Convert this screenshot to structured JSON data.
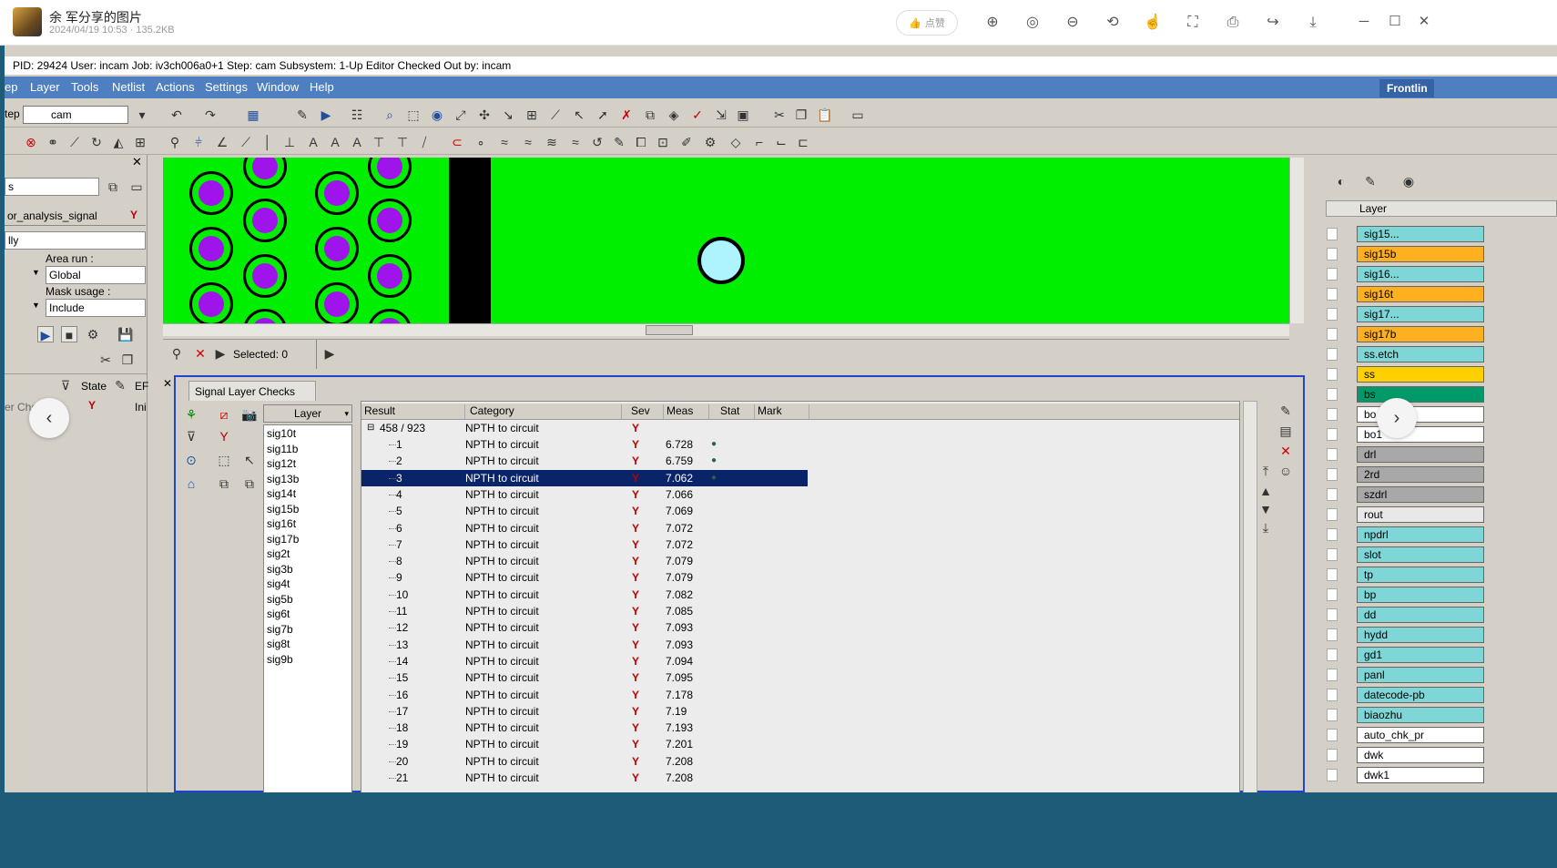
{
  "viewer": {
    "title": "余 军分享的图片",
    "meta": "2024/04/19 10:53 · 135.2KB",
    "like_label": "点赞"
  },
  "app": {
    "status": "PID: 29424   User: incam   Job: iv3ch006a0+1   Step: cam   Subsystem: 1-Up Editor   Checked Out by: incam",
    "menu": [
      "ep",
      "Layer",
      "Tools",
      "Netlist",
      "Actions",
      "Settings",
      "Window",
      "Help"
    ],
    "logo": "Frontlin",
    "step_label": "tep",
    "step_value": "cam"
  },
  "left_panel": {
    "combo_value": "s",
    "analysis_name": "or_analysis_signal",
    "mode": "lly",
    "area_run_label": "Area run :",
    "area_run_value": "Global",
    "mask_usage_label": "Mask usage :",
    "mask_usage_value": "Include",
    "state_label": "State",
    "er_label": "EF",
    "check_row_label": "er Checks",
    "check_row_extra": "Ini"
  },
  "selected": {
    "label": "Selected: 0"
  },
  "check_panel": {
    "tab": "Signal Layer Checks",
    "layer_header": "Layer",
    "layers": [
      "sig10t",
      "sig11b",
      "sig12t",
      "sig13b",
      "sig14t",
      "sig15b",
      "sig16t",
      "sig17b",
      "sig2t",
      "sig3b",
      "sig4t",
      "sig5b",
      "sig6t",
      "sig7b",
      "sig8t",
      "sig9b"
    ],
    "columns": [
      "Result",
      "Category",
      "Sev",
      "Meas",
      "Stat",
      "Mark"
    ],
    "root": "458 / 923",
    "root_category": "NPTH to circuit",
    "rows": [
      {
        "n": "1",
        "cat": "NPTH to circuit",
        "meas": "6.728",
        "stat": "●"
      },
      {
        "n": "2",
        "cat": "NPTH to circuit",
        "meas": "6.759",
        "stat": "●"
      },
      {
        "n": "3",
        "cat": "NPTH to circuit",
        "meas": "7.062",
        "stat": "●"
      },
      {
        "n": "4",
        "cat": "NPTH to circuit",
        "meas": "7.066",
        "stat": ""
      },
      {
        "n": "5",
        "cat": "NPTH to circuit",
        "meas": "7.069",
        "stat": ""
      },
      {
        "n": "6",
        "cat": "NPTH to circuit",
        "meas": "7.072",
        "stat": ""
      },
      {
        "n": "7",
        "cat": "NPTH to circuit",
        "meas": "7.072",
        "stat": ""
      },
      {
        "n": "8",
        "cat": "NPTH to circuit",
        "meas": "7.079",
        "stat": ""
      },
      {
        "n": "9",
        "cat": "NPTH to circuit",
        "meas": "7.079",
        "stat": ""
      },
      {
        "n": "10",
        "cat": "NPTH to circuit",
        "meas": "7.082",
        "stat": ""
      },
      {
        "n": "11",
        "cat": "NPTH to circuit",
        "meas": "7.085",
        "stat": ""
      },
      {
        "n": "12",
        "cat": "NPTH to circuit",
        "meas": "7.093",
        "stat": ""
      },
      {
        "n": "13",
        "cat": "NPTH to circuit",
        "meas": "7.093",
        "stat": ""
      },
      {
        "n": "14",
        "cat": "NPTH to circuit",
        "meas": "7.094",
        "stat": ""
      },
      {
        "n": "15",
        "cat": "NPTH to circuit",
        "meas": "7.095",
        "stat": ""
      },
      {
        "n": "16",
        "cat": "NPTH to circuit",
        "meas": "7.178",
        "stat": ""
      },
      {
        "n": "17",
        "cat": "NPTH to circuit",
        "meas": "7.19",
        "stat": ""
      },
      {
        "n": "18",
        "cat": "NPTH to circuit",
        "meas": "7.193",
        "stat": ""
      },
      {
        "n": "19",
        "cat": "NPTH to circuit",
        "meas": "7.201",
        "stat": ""
      },
      {
        "n": "20",
        "cat": "NPTH to circuit",
        "meas": "7.208",
        "stat": ""
      },
      {
        "n": "21",
        "cat": "NPTH to circuit",
        "meas": "7.208",
        "stat": ""
      }
    ],
    "selected_index": 2
  },
  "right_panel": {
    "header": "Layer",
    "layers": [
      {
        "name": "sig15...",
        "color": "#7fd6d6"
      },
      {
        "name": "sig15b",
        "color": "#ffb020"
      },
      {
        "name": "sig16...",
        "color": "#7fd6d6"
      },
      {
        "name": "sig16t",
        "color": "#ffb020"
      },
      {
        "name": "sig17...",
        "color": "#7fd6d6"
      },
      {
        "name": "sig17b",
        "color": "#ffb020"
      },
      {
        "name": "ss.etch",
        "color": "#7fd6d6"
      },
      {
        "name": "ss",
        "color": "#ffd000"
      },
      {
        "name": "bs",
        "color": "#009a6a"
      },
      {
        "name": "bo",
        "color": "#ffffff"
      },
      {
        "name": "bo1",
        "color": "#ffffff"
      },
      {
        "name": "drl",
        "color": "#a8a8a8"
      },
      {
        "name": "2rd",
        "color": "#a8a8a8"
      },
      {
        "name": "szdrl",
        "color": "#a8a8a8"
      },
      {
        "name": "rout",
        "color": "#e8e8e8"
      },
      {
        "name": "npdrl",
        "color": "#7fd6d6"
      },
      {
        "name": "slot",
        "color": "#7fd6d6"
      },
      {
        "name": "tp",
        "color": "#7fd6d6"
      },
      {
        "name": "bp",
        "color": "#7fd6d6"
      },
      {
        "name": "dd",
        "color": "#7fd6d6"
      },
      {
        "name": "hydd",
        "color": "#7fd6d6"
      },
      {
        "name": "gd1",
        "color": "#7fd6d6"
      },
      {
        "name": "panl",
        "color": "#7fd6d6"
      },
      {
        "name": "datecode-pb",
        "color": "#7fd6d6"
      },
      {
        "name": "biaozhu",
        "color": "#7fd6d6"
      },
      {
        "name": "auto_chk_pr",
        "color": "#ffffff"
      },
      {
        "name": "dwk",
        "color": "#ffffff"
      },
      {
        "name": "dwk1",
        "color": "#ffffff"
      }
    ]
  }
}
